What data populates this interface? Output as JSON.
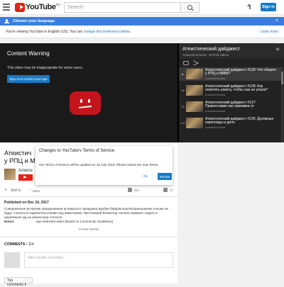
{
  "masthead": {
    "logo_text": "YouTube",
    "logo_country": "RU",
    "search_placeholder": "Search",
    "signin_label": "Sign in"
  },
  "language_banner": {
    "header": "Choose your language",
    "close": "×",
    "text_before": "You're viewing YouTube in English (US). You can ",
    "link": "change this preference below",
    "text_after": ".",
    "learn_more": "Learn more"
  },
  "player": {
    "warning_title": "Content Warning",
    "warning_sub": "This video may be inappropriate for some users.",
    "confirm_label": "Sign in to confirm your age"
  },
  "playlist": {
    "title": "Атеистический дайджест",
    "meta": "Алексей Козлов - 97/216 videos",
    "plus": "+",
    "items": [
      {
        "index": "▶",
        "title": "Атеистический дайджест #129: Что общего у РПЦ и МММ?",
        "channel": "Алексей Козлов"
      },
      {
        "index": "98",
        "title": "Атеистический дайджест #128: Как освятить ракету, чтобы она не упала?",
        "channel": "Алексей Козлов"
      },
      {
        "index": "99",
        "title": "Атеистический дайджест #127: Православие как прививка от",
        "channel": "Алексей Козлов"
      },
      {
        "index": "100",
        "title": "Атеистический дайджест #126: Духовные скрепоеды и дело",
        "channel": "Алексей Козлов"
      }
    ]
  },
  "video": {
    "title_line1": "Атеистич",
    "title_line2": "у РПЦ и МГ",
    "channel": "Алексе",
    "add_to": "Add to",
    "more": "More",
    "likes": "951",
    "dislikes": "17"
  },
  "description": {
    "published": "Published on Dec 10, 2017",
    "text": "Совершенные во время празднования исламского праздника Курбан-байрам жертвоприношения отныне не будут считаться издевательствами над животными. Протоиерей Всеволод Чаплин намерен подать в церковный суд на режиссера Алексея",
    "notice_label": "Notice",
    "notice_value": "Age-restricted video (based on Community Guidelines)",
    "show_more": "SHOW MORE"
  },
  "comments": {
    "label": "COMMENTS",
    "count": "• 114",
    "placeholder": "Add a public comment...",
    "sort": "Top comments ▾"
  },
  "dialog": {
    "title": "Changes to YouTube's Terms of Service",
    "body": "Our Terms of Service will be updated on 22 July 2019. Please review the new Terms.",
    "ok": "Ok",
    "review": "Review"
  },
  "colors": {
    "brand_red": "#e62117",
    "accent_blue": "#167ac6",
    "banner_blue": "#3b7ddd"
  }
}
